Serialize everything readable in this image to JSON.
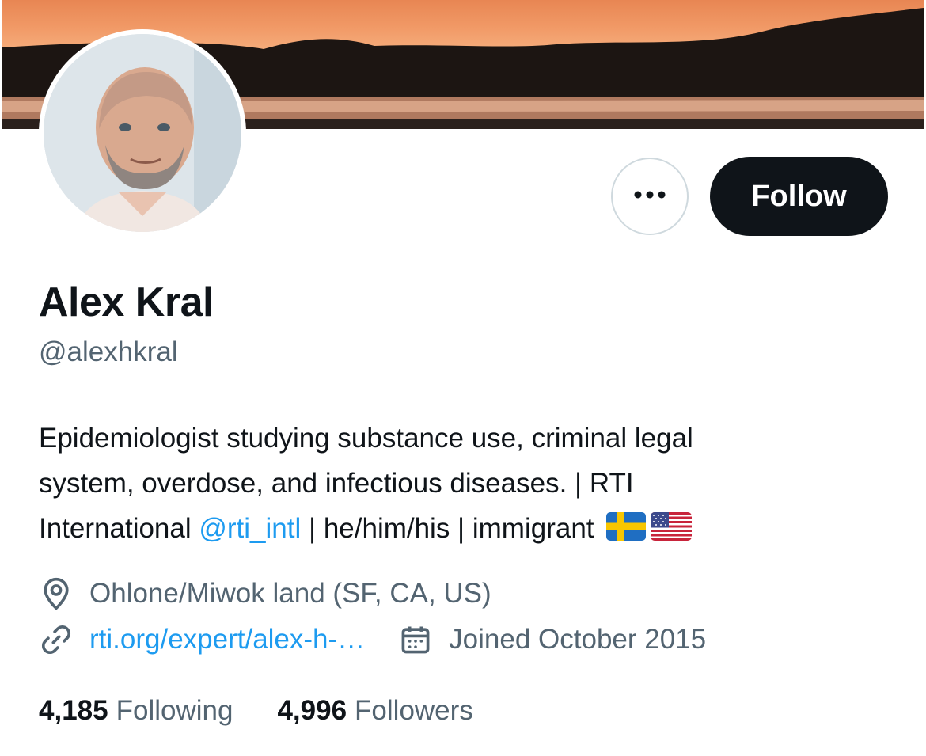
{
  "profile": {
    "display_name": "Alex Kral",
    "handle": "@alexhkral",
    "bio": {
      "line1": "Epidemiologist studying substance use, criminal legal",
      "line2": "system, overdose, and infectious diseases. | RTI",
      "line3_pre": "International ",
      "mention": "@rti_intl",
      "line3_post": " | he/him/his | immigrant",
      "flags": [
        "flag-sweden",
        "flag-usa"
      ]
    },
    "location": "Ohlone/Miwok land (SF, CA, US)",
    "website": "rti.org/expert/alex-h-…",
    "joined": "Joined October 2015",
    "following_count": "4,185",
    "following_label": "Following",
    "followers_count": "4,996",
    "followers_label": "Followers"
  },
  "actions": {
    "follow_label": "Follow",
    "more_icon": "ellipsis-icon"
  },
  "colors": {
    "link": "#1d9bf0",
    "secondary_text": "#536471",
    "follow_bg": "#0f1419"
  }
}
